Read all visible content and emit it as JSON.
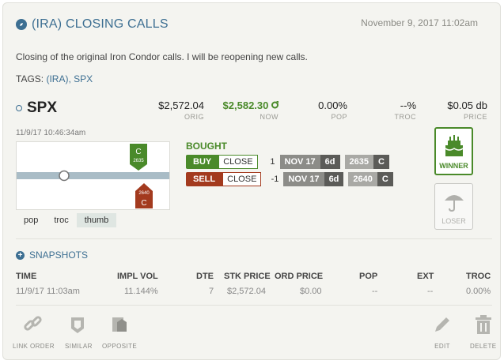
{
  "header": {
    "title": "(IRA) CLOSING CALLS",
    "date": "November 9, 2017 11:02am"
  },
  "description": "Closing of the original Iron Condor calls. I will be reopening new calls.",
  "tags": {
    "label": "TAGS:",
    "values": "(IRA), SPX"
  },
  "position": {
    "symbol": "SPX",
    "orig": {
      "value": "$2,572.04",
      "label": "ORIG"
    },
    "now": {
      "value": "$2,582.30",
      "label": "NOW"
    },
    "pop": {
      "value": "0.00%",
      "label": "POP"
    },
    "troc": {
      "value": "--%",
      "label": "TROC"
    },
    "price": {
      "value": "$0.05 db",
      "label": "PRICE"
    },
    "timestamp": "11/9/17 10:46:34am"
  },
  "chart": {
    "markers": [
      {
        "type": "C",
        "strike": "2635",
        "color": "#4a8a2a"
      },
      {
        "type": "C",
        "strike": "2640",
        "color": "#a33a1e"
      }
    ]
  },
  "view_tabs": [
    "pop",
    "troc",
    "thumb"
  ],
  "legs": {
    "heading": "BOUGHT",
    "rows": [
      {
        "action": "BUY",
        "close": "CLOSE",
        "qty": "1",
        "month": "NOV 17",
        "dte": "6d",
        "strike": "2635",
        "type": "C"
      },
      {
        "action": "SELL",
        "close": "CLOSE",
        "qty": "-1",
        "month": "NOV 17",
        "dte": "6d",
        "strike": "2640",
        "type": "C"
      }
    ]
  },
  "outcome": {
    "winner": "WINNER",
    "loser": "LOSER"
  },
  "snapshots": {
    "title": "SNAPSHOTS",
    "columns": [
      "TIME",
      "IMPL VOL",
      "DTE",
      "STK PRICE",
      "ORD PRICE",
      "POP",
      "EXT",
      "TROC"
    ],
    "row": [
      "11/9/17 11:03am",
      "11.144%",
      "7",
      "$2,572.04",
      "$0.00",
      "--",
      "--",
      "0.00%"
    ]
  },
  "actions": {
    "link": "LINK ORDER",
    "similar": "SIMILAR",
    "opposite": "OPPOSITE",
    "edit": "EDIT",
    "delete": "DELETE"
  },
  "colors": {
    "accent": "#3d6f92",
    "buy": "#4a8a2a",
    "sell": "#a33a1e"
  }
}
